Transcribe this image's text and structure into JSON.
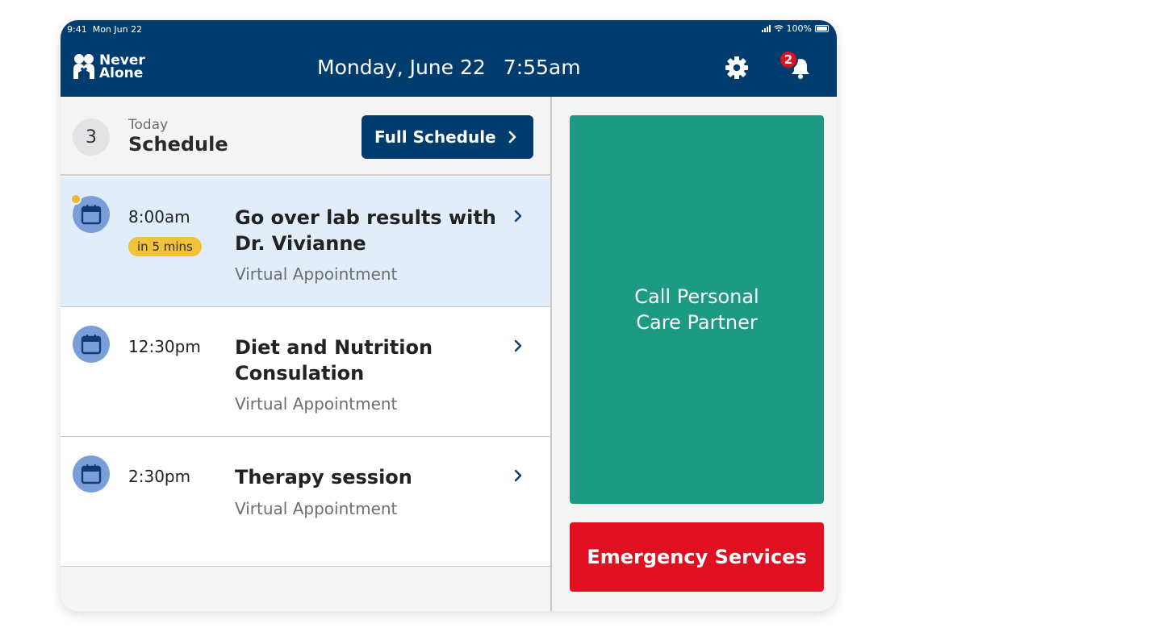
{
  "status_bar": {
    "time": "9:41",
    "date": "Mon Jun 22",
    "battery": "100%"
  },
  "header": {
    "logo_line1": "Never",
    "logo_line2": "Alone",
    "date": "Monday, June 22",
    "time": "7:55am",
    "notification_count": "2"
  },
  "schedule": {
    "count": "3",
    "today_label": "Today",
    "title": "Schedule",
    "full_schedule_label": "Full Schedule",
    "appointments": [
      {
        "time": "8:00am",
        "badge": "in 5 mins",
        "title": "Go over lab results with Dr. Vivianne",
        "subtitle": "Virtual Appointment"
      },
      {
        "time": "12:30pm",
        "title": "Diet and Nutrition Consulation",
        "subtitle": "Virtual Appointment"
      },
      {
        "time": "2:30pm",
        "title": "Therapy session",
        "subtitle": "Virtual Appointment"
      }
    ]
  },
  "actions": {
    "call_line1": "Call Personal",
    "call_line2": "Care Partner",
    "emergency": "Emergency Services"
  },
  "colors": {
    "header_bg": "#003c6e",
    "call_bg": "#1c9a83",
    "emergency_bg": "#e01020",
    "active_row_bg": "#e1eef9",
    "soon_badge": "#f0c239",
    "calendar_icon_bg": "#7a9fd8"
  }
}
